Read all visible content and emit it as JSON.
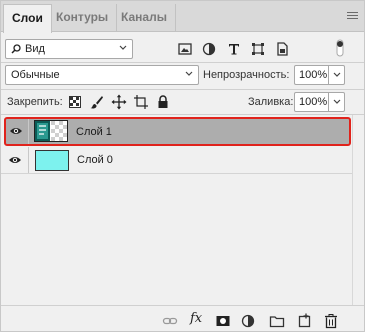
{
  "tabs": [
    {
      "label": "Слои",
      "active": true
    },
    {
      "label": "Контуры",
      "active": false
    },
    {
      "label": "Каналы",
      "active": false
    }
  ],
  "filter": {
    "kind_label": "Вид",
    "icons": [
      "image-filter-icon",
      "adjustment-filter-icon",
      "type-filter-icon",
      "shape-filter-icon",
      "smart-object-filter-icon",
      "filter-toggle-icon"
    ]
  },
  "blend": {
    "mode": "Обычные",
    "opacity_label": "Непрозрачность:",
    "opacity_value": "100%"
  },
  "lock": {
    "label": "Закрепить:",
    "icons": [
      "lock-transparent-pixels-icon",
      "lock-image-pixels-icon",
      "lock-position-icon",
      "lock-artboard-icon",
      "lock-all-icon"
    ],
    "fill_label": "Заливка:",
    "fill_value": "100%"
  },
  "layers": [
    {
      "name": "Слой 1",
      "selected": true,
      "visible": true,
      "highlight_color": "#e0231c"
    },
    {
      "name": "Слой 0",
      "selected": false,
      "visible": true,
      "swatch_color": "#7df2ee"
    }
  ],
  "colors": {
    "selected_row": "#adadad",
    "highlight": "#e0231c",
    "layer0_fill": "#7df2ee"
  },
  "bottom_icons": [
    "link-layers-icon",
    "fx-icon",
    "add-mask-icon",
    "new-adjustment-icon",
    "new-group-icon",
    "new-layer-icon",
    "delete-icon"
  ],
  "bottom_fx_label": "fx"
}
